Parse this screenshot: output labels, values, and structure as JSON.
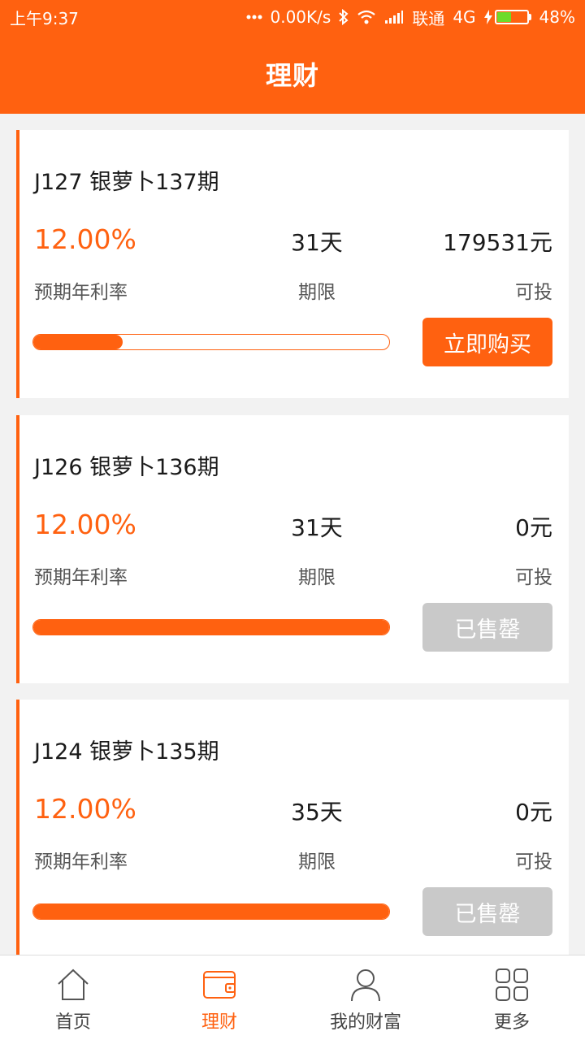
{
  "status_bar": {
    "time": "上午9:37",
    "net_speed": "0.00K/s",
    "carrier": "联通",
    "network": "4G",
    "battery": "48%",
    "battery_level": 0.48,
    "icons": [
      "more-dots-icon",
      "bluetooth-icon",
      "wifi-icon",
      "signal-icon",
      "charging-icon",
      "battery-icon"
    ]
  },
  "header": {
    "title": "理财"
  },
  "labels": {
    "rate": "预期年利率",
    "period": "期限",
    "amount": "可投"
  },
  "products": [
    {
      "title": "J127 银萝卜137期",
      "rate": "12.00%",
      "period": "31天",
      "amount": "179531元",
      "progress": 0.25,
      "button": "立即购买",
      "button_state": "active"
    },
    {
      "title": "J126 银萝卜136期",
      "rate": "12.00%",
      "period": "31天",
      "amount": "0元",
      "progress": 1.0,
      "button": "已售罄",
      "button_state": "disabled"
    },
    {
      "title": "J124 银萝卜135期",
      "rate": "12.00%",
      "period": "35天",
      "amount": "0元",
      "progress": 1.0,
      "button": "已售罄",
      "button_state": "disabled"
    }
  ],
  "tabs": [
    {
      "label": "首页",
      "icon": "home-icon",
      "active": false
    },
    {
      "label": "理财",
      "icon": "wallet-icon",
      "active": true
    },
    {
      "label": "我的财富",
      "icon": "user-icon",
      "active": false
    },
    {
      "label": "更多",
      "icon": "grid-icon",
      "active": false
    }
  ],
  "colors": {
    "accent": "#ff6110",
    "disabled": "#c9c9c9",
    "background": "#f2f2f2"
  }
}
